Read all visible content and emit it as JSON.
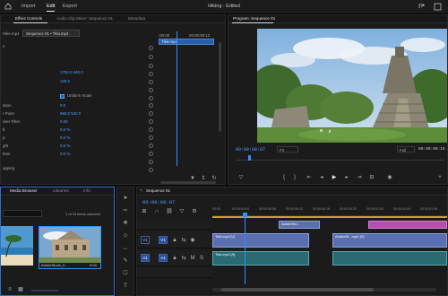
{
  "app": {
    "title": "Hiking - Edited",
    "menu": [
      "Import",
      "Edit",
      "Export"
    ]
  },
  "effect_controls": {
    "tabs": [
      "Effect Controls",
      "Audio Clip Mixer: Sequence 01",
      "Metadata"
    ],
    "source": "Hike.mp4",
    "sequence_chip": "Sequence 01 • TikiLmp4",
    "mini_time_start": ";00:00",
    "mini_time_end": "00:00:00:12",
    "mini_clip": "TikiLmp4",
    "params": [
      {
        "label": "n",
        "value": ""
      },
      {
        "label": "",
        "value": "1750.0   540.0"
      },
      {
        "label": "",
        "value": "100.0"
      },
      {
        "label": "",
        "value": ""
      },
      {
        "label": "",
        "value": "Uniform Scale"
      },
      {
        "label": "ation",
        "value": "0.0"
      },
      {
        "label": "r Point",
        "value": "960.0   540.0"
      },
      {
        "label": "cker Filter",
        "value": "0.00"
      },
      {
        "label": "ft",
        "value": "0.0 %"
      },
      {
        "label": "p",
        "value": "0.0 %"
      },
      {
        "label": "ght",
        "value": "0.0 %"
      },
      {
        "label": "ttom",
        "value": "0.0 %"
      },
      {
        "label": "",
        "value": ""
      },
      {
        "label": "apping",
        "value": ""
      }
    ]
  },
  "program": {
    "title": "Program: Sequence 01",
    "timecode": "00:00:00:07",
    "fit": "Fit",
    "quality": "Full",
    "duration": "00:00:00:16"
  },
  "media": {
    "tabs": [
      "Media Browser",
      "Libraries",
      "Info"
    ],
    "count": "1 of 16 items selected",
    "items": [
      {
        "name": "",
        "duration": ""
      },
      {
        "name": "AdobeStock_2...",
        "duration": "0:03"
      }
    ]
  },
  "timeline": {
    "tab": "Sequence 01",
    "timecode": "00:00:00:07",
    "ruler": [
      "00:00",
      "00:00:00:04",
      "00:00:00:08",
      "00:00:00:12",
      "00:00:00:16",
      "00:00:00:20",
      "00:00:01:00",
      "00:00:01:04",
      "00:00:01:08"
    ],
    "tracks": [
      {
        "tag": "V1",
        "name": "V1"
      },
      {
        "tag": "A1",
        "name": "A1"
      }
    ],
    "clips": [
      {
        "label": "AdobeSto...",
        "track": "V2"
      },
      {
        "label": "TikiLmp4 [V]",
        "track": "V1"
      },
      {
        "label": "AdobeSt...mp4 [V]",
        "track": "V1"
      },
      {
        "label": "TikiLmp4 [A]",
        "track": "A1"
      }
    ]
  },
  "colors": {
    "accent": "#4aa3ff",
    "clip_video": "#5a6fb0",
    "clip_audio": "#2a6b73",
    "clip_pink": "#b44fb0"
  }
}
